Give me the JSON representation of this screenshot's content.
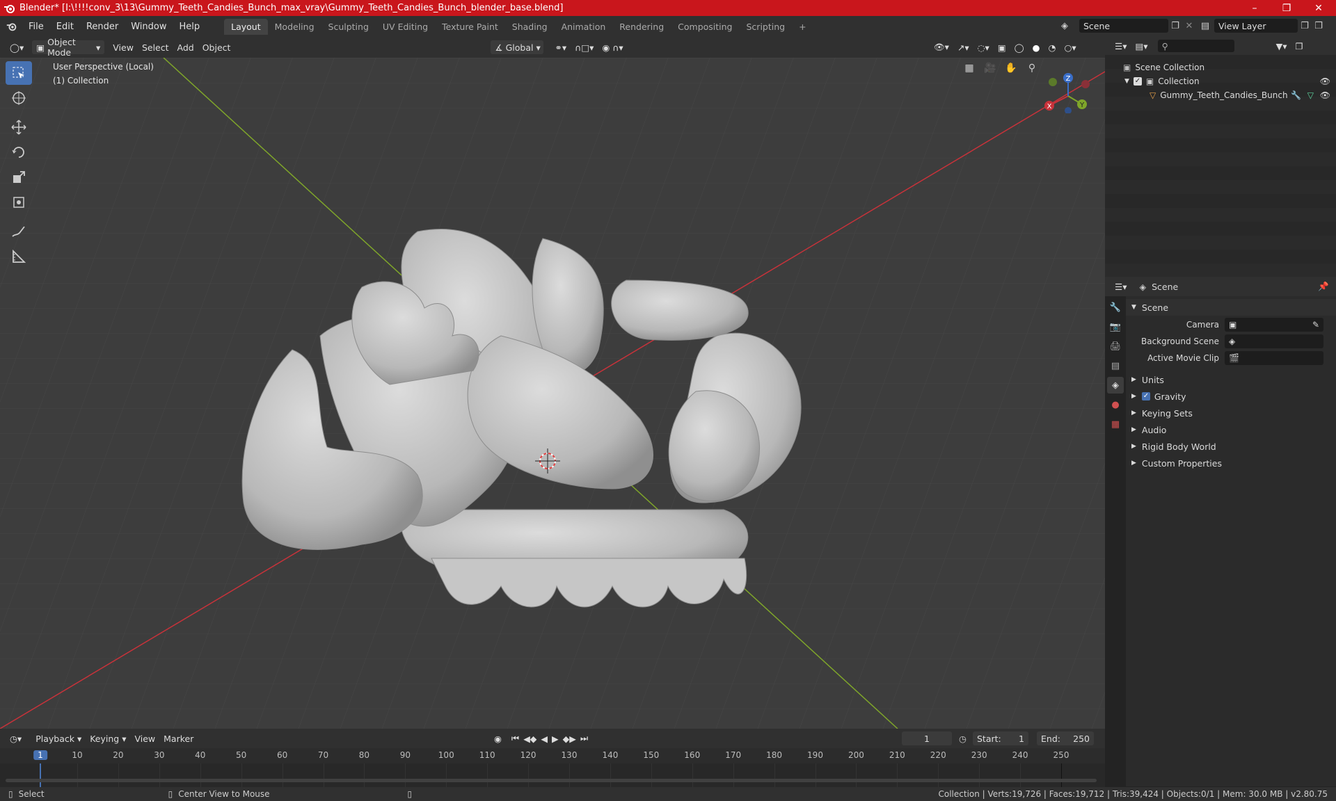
{
  "window": {
    "title": "Blender* [I:\\!!!!conv_3\\13\\Gummy_Teeth_Candies_Bunch_max_vray\\Gummy_Teeth_Candies_Bunch_blender_base.blend]"
  },
  "menu": [
    "File",
    "Edit",
    "Render",
    "Window",
    "Help"
  ],
  "workspaces": [
    "Layout",
    "Modeling",
    "Sculpting",
    "UV Editing",
    "Texture Paint",
    "Shading",
    "Animation",
    "Rendering",
    "Compositing",
    "Scripting"
  ],
  "top_right": {
    "scene": "Scene",
    "view_layer": "View Layer"
  },
  "viewport_header": {
    "mode": "Object Mode",
    "view": "View",
    "select": "Select",
    "add": "Add",
    "object": "Object",
    "transform": "Global"
  },
  "viewport": {
    "perspective": "User Perspective (Local)",
    "collection": "(1) Collection",
    "axis_x": "X",
    "axis_y": "Y",
    "axis_z": "Z"
  },
  "outliner": {
    "root": "Scene Collection",
    "collection": "Collection",
    "object": "Gummy_Teeth_Candies_Bunch"
  },
  "properties": {
    "header": "Scene",
    "section": "Scene",
    "camera_label": "Camera",
    "background_label": "Background Scene",
    "movieclip_label": "Active Movie Clip",
    "collapsed": [
      "Units",
      "Gravity",
      "Keying Sets",
      "Audio",
      "Rigid Body World",
      "Custom Properties"
    ]
  },
  "timeline": {
    "playback": "Playback",
    "keying": "Keying",
    "view": "View",
    "marker": "Marker",
    "current_frame": "1",
    "start_label": "Start:",
    "start": "1",
    "end_label": "End:",
    "end": "250",
    "ticks": [
      "1",
      "10",
      "20",
      "30",
      "40",
      "50",
      "60",
      "70",
      "80",
      "90",
      "100",
      "110",
      "120",
      "130",
      "140",
      "150",
      "160",
      "170",
      "180",
      "190",
      "200",
      "210",
      "220",
      "230",
      "240",
      "250"
    ]
  },
  "status": {
    "select": "Select",
    "center": "Center View to Mouse",
    "stats": "Collection | Verts:19,726 | Faces:19,712 | Tris:39,424 | Objects:0/1 | Mem: 30.0 MB | v2.80.75"
  },
  "colors": {
    "title_bar": "#c9161c",
    "accent": "#4772b3",
    "axis_red": "#c8323a",
    "axis_green": "#7fa62a"
  }
}
